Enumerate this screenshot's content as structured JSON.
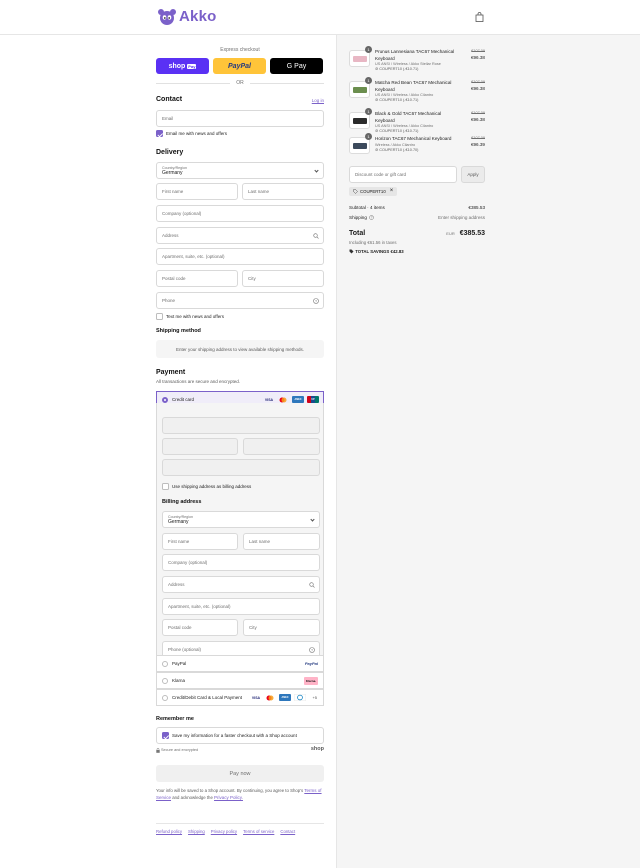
{
  "header": {
    "brand": "Akko",
    "cart_icon": "shopping-bag-icon"
  },
  "express": {
    "label": "Express checkout",
    "buttons": [
      {
        "label": "shop",
        "badge": "Pay"
      },
      {
        "label": "PayPal"
      },
      {
        "label": "G Pay"
      }
    ],
    "or": "OR"
  },
  "contact": {
    "title": "Contact",
    "login": "Log in",
    "email_placeholder": "Email",
    "news_label": "Email me with news and offers"
  },
  "delivery": {
    "title": "Delivery",
    "country_label": "Country/Region",
    "country_value": "Germany",
    "first_name": "First name",
    "last_name": "Last name",
    "company": "Company (optional)",
    "address": "Address",
    "apartment": "Apartment, suite, etc. (optional)",
    "postal": "Postal code",
    "city": "City",
    "phone": "Phone",
    "text_label": "Text me with news and offers"
  },
  "shipping": {
    "title": "Shipping method",
    "message": "Enter your shipping address to view available shipping methods."
  },
  "payment": {
    "title": "Payment",
    "subtitle": "All transactions are secure and encrypted.",
    "credit_card": "Credit card",
    "card_brands": [
      "VISA",
      "MC",
      "AMEX",
      "UP"
    ],
    "same_address": "Use shipping address as billing address",
    "billing_title": "Billing address",
    "billing": {
      "country_label": "Country/Region",
      "country_value": "Germany",
      "first_name": "First name",
      "last_name": "Last name",
      "company": "Company (optional)",
      "address": "Address",
      "apartment": "Apartment, suite, etc. (optional)",
      "postal": "Postal code",
      "city": "City",
      "phone": "Phone (optional)"
    },
    "paypal": "PayPal",
    "paypal_logo": "PayPal",
    "klarna": "Klarna",
    "klarna_logo": "Klarna.",
    "local": "Credit/Debit Card & Local Payment",
    "local_more": "+5"
  },
  "remember": {
    "title": "Remember me",
    "save_label": "Save my information for a faster checkout with a Shop account",
    "secure": "Secure and encrypted",
    "shop_logo": "shop"
  },
  "pay_now": "Pay now",
  "terms": {
    "line1": "Your info will be saved to a Shop account. By continuing, you agree to Shop's",
    "tos": "Terms of Service",
    "and": "and acknowledge the",
    "privacy": "Privacy Policy."
  },
  "footer_links": [
    "Refund policy",
    "Shipping",
    "Privacy policy",
    "Terms of service",
    "Contact"
  ],
  "order": {
    "products": [
      {
        "qty": "1",
        "name": "Prunus Lannesiana TAC67 Mechanical Keyboard",
        "variant": "US ANSI / Wireless / Akko Stellar Rose",
        "discount": "COUPERT10 (-€10.71)",
        "old": "€107.09",
        "price": "€96.38",
        "color": "#e8b7c4"
      },
      {
        "qty": "1",
        "name": "Matcha Red Bean TAC67 Mechanical Keyboard",
        "variant": "US ANSI / Wireless / Akko Cilantro",
        "discount": "COUPERT10 (-€10.71)",
        "old": "€107.09",
        "price": "€96.38",
        "color": "#6b8e4e"
      },
      {
        "qty": "1",
        "name": "Black & Gold TAC67 Mechanical Keyboard",
        "variant": "US ANSI / Wireless / Akko Cilantro",
        "discount": "COUPERT10 (-€10.71)",
        "old": "€107.09",
        "price": "€96.38",
        "color": "#2b2b2b"
      },
      {
        "qty": "1",
        "name": "Horizon TAC67 Mechanical Keyboard",
        "variant": "Wireless / Akko Cilantro",
        "discount": "COUPERT10 (-€10.70)",
        "old": "€107.09",
        "price": "€96.39",
        "color": "#3c4a5c"
      }
    ],
    "discount_placeholder": "Discount code or gift card",
    "apply": "Apply",
    "chip": "COUPERT10",
    "subtotal_label": "Subtotal · 4 items",
    "subtotal": "€385.53",
    "shipping_label": "Shipping",
    "shipping_value": "Enter shipping address",
    "total_label": "Total",
    "currency": "EUR",
    "total": "€385.53",
    "taxes": "Including €61.56 in taxes",
    "savings_label": "TOTAL SAVINGS",
    "savings": "€42.83"
  }
}
